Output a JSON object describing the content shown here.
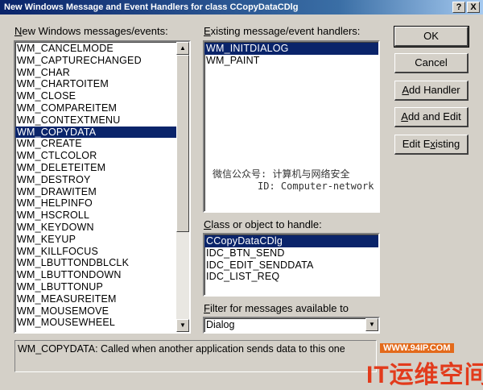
{
  "window": {
    "title": "New Windows Message and Event Handlers for class CCopyDataCDlg",
    "help_btn": "?",
    "close_btn": "X"
  },
  "messages_panel": {
    "label_prefix": "N",
    "label_rest": "ew Windows messages/events:",
    "items": [
      "WM_CANCELMODE",
      "WM_CAPTURECHANGED",
      "WM_CHAR",
      "WM_CHARTOITEM",
      "WM_CLOSE",
      "WM_COMPAREITEM",
      "WM_CONTEXTMENU",
      "WM_COPYDATA",
      "WM_CREATE",
      "WM_CTLCOLOR",
      "WM_DELETEITEM",
      "WM_DESTROY",
      "WM_DRAWITEM",
      "WM_HELPINFO",
      "WM_HSCROLL",
      "WM_KEYDOWN",
      "WM_KEYUP",
      "WM_KILLFOCUS",
      "WM_LBUTTONDBLCLK",
      "WM_LBUTTONDOWN",
      "WM_LBUTTONUP",
      "WM_MEASUREITEM",
      "WM_MOUSEMOVE",
      "WM_MOUSEWHEEL"
    ],
    "selected": "WM_COPYDATA"
  },
  "handlers_panel": {
    "label_prefix": "E",
    "label_rest": "xisting message/event handlers:",
    "items": [
      "WM_INITDIALOG",
      "WM_PAINT"
    ],
    "selected": "WM_INITDIALOG"
  },
  "watermark": {
    "line1": "微信公众号: 计算机与网络安全",
    "line2": "ID: Computer-network"
  },
  "class_panel": {
    "label_prefix": "C",
    "label_rest": "lass or object to handle:",
    "items": [
      "CCopyDataCDlg",
      "IDC_BTN_SEND",
      "IDC_EDIT_SENDDATA",
      "IDC_LIST_REQ"
    ],
    "selected": "CCopyDataCDlg"
  },
  "filter": {
    "label_prefix": "F",
    "label_rest": "ilter for messages available to",
    "value": "Dialog"
  },
  "buttons": {
    "ok": "OK",
    "cancel": "Cancel",
    "add_handler_prefix": "A",
    "add_handler_rest": "dd Handler",
    "add_edit_prefix": "A",
    "add_edit_rest": "dd and Edit",
    "edit_existing_a": "Edit E",
    "edit_existing_b": "x",
    "edit_existing_c": "isting"
  },
  "status_text": "WM_COPYDATA:  Called when another application sends data to this one",
  "site_watermark": {
    "url": "WWW.94IP.COM",
    "name": "IT运维空间"
  }
}
